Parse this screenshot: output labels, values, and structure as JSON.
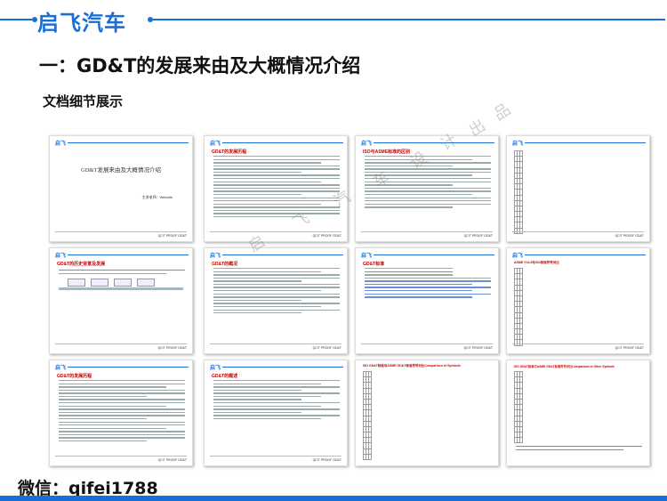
{
  "header": {
    "logo": "启飞汽车",
    "title": "一：GD&T的发展来由及大概情况介绍",
    "subtitle": "文档细节展示"
  },
  "footer": {
    "contact": "微信：qifei1788"
  },
  "watermark": {
    "chars": [
      "启",
      "飞",
      "汽",
      "车",
      "设",
      "计",
      "出",
      "品"
    ]
  },
  "pages": {
    "logo": "启飞",
    "foot": "QC/T PROOF GD&T",
    "p1": {
      "cover_title": "GD&T发展来由及大概情况介绍",
      "author": "主讲老师：Website"
    },
    "p2": {
      "title": "GD&T的发展历程"
    },
    "p3": {
      "title": "ISO与ASME标准的区别"
    },
    "p4": {
      "title": ""
    },
    "p5": {
      "title": "GD&T的历史背景及发展"
    },
    "p6": {
      "title": "GD&T的概况"
    },
    "p7": {
      "title": "GD&T标准"
    },
    "p8": {
      "title": "ASME Y14.5与ISO标准符号对比"
    },
    "p9": {
      "title": "GD&T的发展历程"
    },
    "p10": {
      "title": "GD&T的概述"
    },
    "p11": {
      "title": "ISO GD&T标准与ASME GD&T标准符号对比Comparison of Symbols"
    },
    "p12": {
      "title": "ISO GD&T标准与ASME GD&T标准符号对比Comparison of Other Symbols"
    }
  }
}
